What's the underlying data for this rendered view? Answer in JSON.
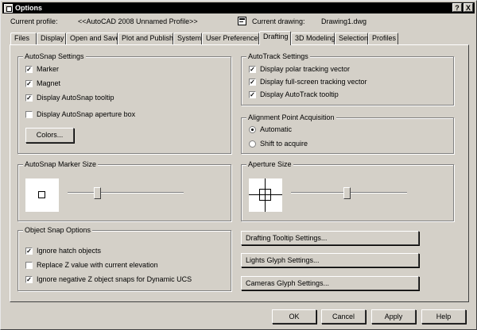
{
  "window": {
    "title": "Options",
    "help_button": "?",
    "close_button": "X"
  },
  "profile": {
    "current_profile_label": "Current profile:",
    "current_profile_value": "<<AutoCAD 2008 Unnamed Profile>>",
    "current_drawing_label": "Current drawing:",
    "current_drawing_value": "Drawing1.dwg"
  },
  "tabs": [
    {
      "label": "Files"
    },
    {
      "label": "Display"
    },
    {
      "label": "Open and Save"
    },
    {
      "label": "Plot and Publish"
    },
    {
      "label": "System"
    },
    {
      "label": "User Preferences"
    },
    {
      "label": "Drafting",
      "active": true
    },
    {
      "label": "3D Modeling"
    },
    {
      "label": "Selection"
    },
    {
      "label": "Profiles"
    }
  ],
  "autosnap": {
    "title": "AutoSnap Settings",
    "marker": {
      "label": "Marker",
      "checked": true
    },
    "magnet": {
      "label": "Magnet",
      "checked": true
    },
    "tooltip": {
      "label": "Display AutoSnap tooltip",
      "checked": true
    },
    "aperture_box": {
      "label": "Display AutoSnap aperture box",
      "checked": false
    },
    "colors_button": "Colors..."
  },
  "autotrack": {
    "title": "AutoTrack Settings",
    "polar": {
      "label": "Display polar tracking vector",
      "checked": true
    },
    "fullscreen": {
      "label": "Display full-screen tracking vector",
      "checked": true
    },
    "tooltip": {
      "label": "Display AutoTrack tooltip",
      "checked": true
    }
  },
  "alignment": {
    "title": "Alignment Point Acquisition",
    "automatic": {
      "label": "Automatic",
      "selected": true
    },
    "shift": {
      "label": "Shift to acquire",
      "selected": false
    }
  },
  "marker_size": {
    "title": "AutoSnap Marker Size",
    "slider_level": 0.24
  },
  "aperture_size": {
    "title": "Aperture Size",
    "slider_level": 0.48
  },
  "object_snap": {
    "title": "Object Snap Options",
    "hatch": {
      "label": "Ignore hatch objects",
      "checked": true
    },
    "replace_z": {
      "label": "Replace Z value with current elevation",
      "checked": false
    },
    "negative_z": {
      "label": "Ignore negative Z object snaps for Dynamic UCS",
      "checked": true
    }
  },
  "side_buttons": {
    "drafting_tooltip": "Drafting Tooltip Settings...",
    "lights_glyph": "Lights Glyph Settings...",
    "cameras_glyph": "Cameras Glyph Settings..."
  },
  "footer": {
    "ok": "OK",
    "cancel": "Cancel",
    "apply": "Apply",
    "help": "Help"
  }
}
